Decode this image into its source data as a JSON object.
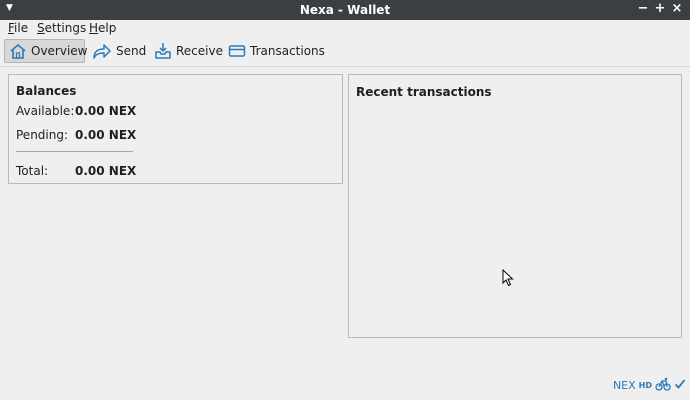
{
  "window": {
    "title": "Nexa - Wallet"
  },
  "titlebar_controls": {
    "minimize": "−",
    "maximize": "+",
    "close": "×"
  },
  "menu": [
    {
      "label": "File",
      "mnemonic": "F",
      "rest": "ile"
    },
    {
      "label": "Settings",
      "mnemonic": "S",
      "rest": "ettings"
    },
    {
      "label": "Help",
      "mnemonic": "H",
      "rest": "elp"
    }
  ],
  "toolbar": {
    "overview": "Overview",
    "send": "Send",
    "receive": "Receive",
    "transactions": "Transactions",
    "active": "overview"
  },
  "balances": {
    "heading": "Balances",
    "available_label": "Available:",
    "available_value": "0.00 NEX",
    "pending_label": "Pending:",
    "pending_value": "0.00 NEX",
    "total_label": "Total:",
    "total_value": "0.00 NEX"
  },
  "recent": {
    "heading": "Recent transactions"
  },
  "status": {
    "unit": "NEX",
    "hd": "HD"
  },
  "colors": {
    "accent": "#2b7ab8",
    "titlebar": "#3b3f42",
    "background": "#efefef"
  }
}
